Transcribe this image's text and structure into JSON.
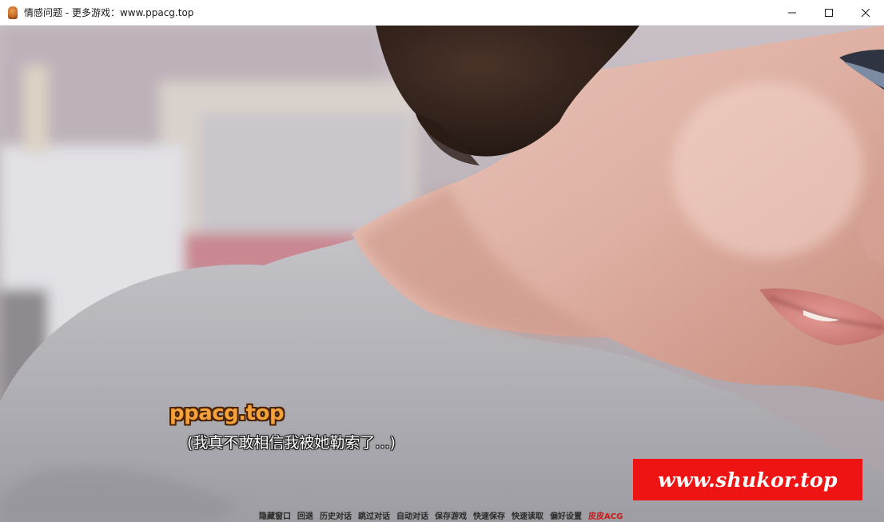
{
  "window": {
    "title": "情感问题 - 更多游戏：www.ppacg.top",
    "icon": "app-icon",
    "controls": [
      "minimize-icon",
      "maximize-icon",
      "close-icon"
    ]
  },
  "game": {
    "watermark": "ppacg.top",
    "dialogue": "(我真不敢相信我被她勒索了...)",
    "overlay_banner": "www.shukor.top",
    "colors": {
      "banner_bg": "#ef1414",
      "watermark": "#f5a23a",
      "accent_menu": "#cc1a1a"
    }
  },
  "quick_menu": {
    "items": [
      {
        "label": "隐藏窗口"
      },
      {
        "label": "回退"
      },
      {
        "label": "历史对话"
      },
      {
        "label": "跳过对话"
      },
      {
        "label": "自动对话"
      },
      {
        "label": "保存游戏"
      },
      {
        "label": "快速保存"
      },
      {
        "label": "快速读取"
      },
      {
        "label": "偏好设置"
      },
      {
        "label": "皮皮ACG"
      }
    ]
  }
}
